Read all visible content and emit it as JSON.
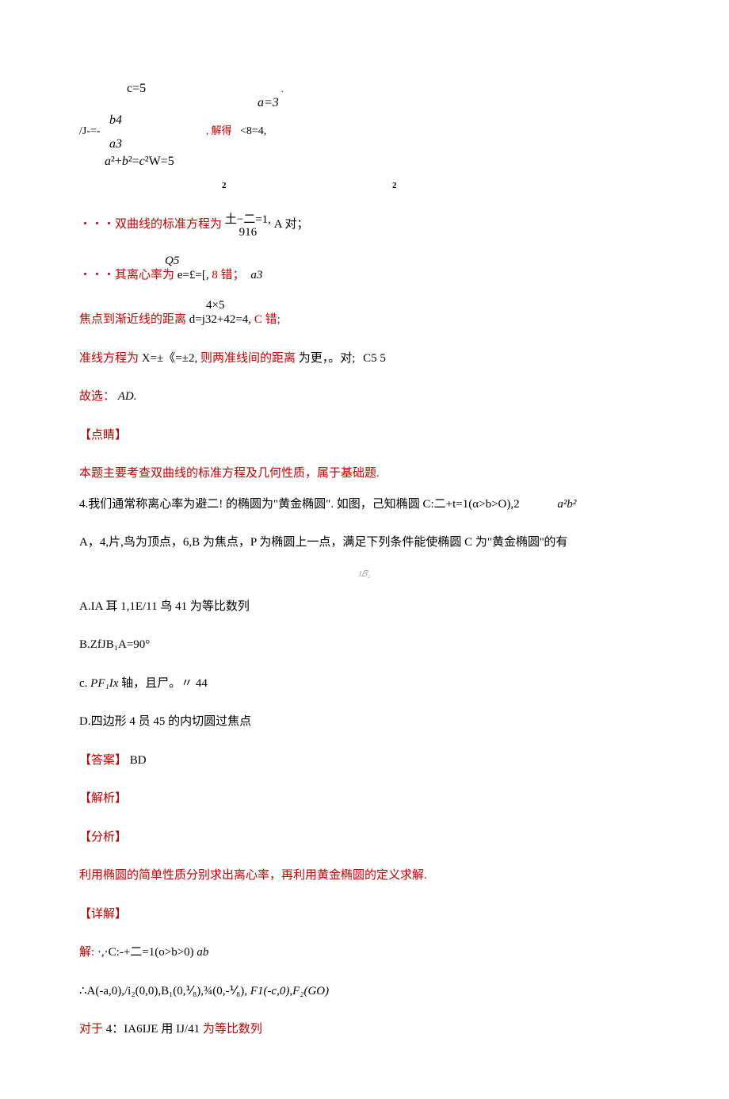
{
  "top": {
    "c5": "c=5",
    "a3i": "a=3",
    "dot": ".",
    "b4": "b4",
    "jprefix": "/J-=-",
    "jiede": ", 解得",
    "lt84": "<8=4,",
    "a3": "a3",
    "abc_html": "a²+b²=c²W=5"
  },
  "sup_l": "2",
  "sup_r": "2",
  "hyperbola": {
    "pre": "・・・双曲线的标准方程为",
    "mid1": "土−二=1,",
    "mid2": "A 对；",
    "den": "916"
  },
  "ecc": {
    "pre": "・・・其离心率为",
    "mid": "e=£=[,",
    "err": "8 错；",
    "tail": "a3",
    "top": "Q5"
  },
  "focus": {
    "pre": "焦点到渐近线的距离",
    "mid": "d=j32+42=4,",
    "err": "C 错;",
    "top": "4×5"
  },
  "zhunxian": {
    "pre": "准线方程为",
    "mid1": "X=±《=±2,",
    "mid2": "则两准线间的距离",
    "mid3": "为更，。对;",
    "tail": "C5    5"
  },
  "guxuan": {
    "pre": "故选：",
    "ans": "AD."
  },
  "dianjing": "【点睛】",
  "summary": "本题主要考查双曲线的标准方程及几何性质，属于基础题.",
  "q4line1": {
    "pre": "4.我们通常称离心率为避二! 的椭圆为\"黄金椭圆\". 如图，己知椭圆",
    "mid": "C:二+t=1(α>b>O),2",
    "tail": "a²b²"
  },
  "q4line2": "A，4,片,鸟为顶点，6,B 为焦点，P 为椭圆上一点，满足下列条件能使椭圆 C 为\"黄金椭圆''的有",
  "figlabel": "I𝐵₂",
  "optA": "A.IA 耳 1,1E/11 鸟 41 为等比数列",
  "optB": "B.ZfJB₁A=90°",
  "optC": {
    "pre": "c.",
    "mid": "PF₁Ix",
    "post": "轴，且尸。〃",
    "tail": "44"
  },
  "optD": "D.四边形 4 员 45 的内切圆过焦点",
  "answer": {
    "label": "【答案】",
    "val": "BD"
  },
  "jiexi": "【解析】",
  "fenxi": "【分析】",
  "analysis": "利用椭圆的简单性质分别求出离心率，再利用黄金椭圆的定义求解.",
  "xiangjie": "【详解】",
  "solline1": {
    "pre": "解:",
    "mid": "·,·C:-+二=1(o>b>0)",
    "tail": "ab"
  },
  "solline2": {
    "pre": "∴A(-a,0),/i₂(0,0),B₁(0,⅟₈),¾(0,-⅟₈),",
    "mid": "F1(-c,0),F₂(GO)"
  },
  "solline3": {
    "pre": "对于",
    "mid": "4：IA6IJE 用 IJ/41",
    "post": "为等比数列"
  }
}
